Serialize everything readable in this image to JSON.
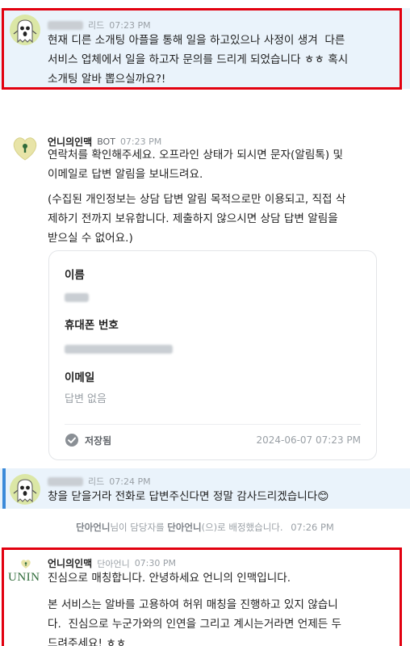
{
  "colors": {
    "highlight": "#e2000f",
    "user_bg": "#eaf3fb",
    "accent_bar": "#3b8ad9"
  },
  "messages": [
    {
      "role_tag": "리드",
      "time": "07:23 PM",
      "text": "현재 디른 소개팅 아플을 통해 일을 하고있으나 사정이 생겨  다른\n서비스 업체에서 일을 하고자 문의를 드리게 되었습니다 ㅎㅎ 혹시\n소개팅 알바 뽑으실까요?!"
    },
    {
      "name": "언니의인맥",
      "tag": "BOT",
      "time": "07:23 PM",
      "text1": "연락처를 확인해주세요. 오프라인 상태가 되시면 문자(알림톡) 및\n이메일로 답변 알림을 보내드려요.",
      "text2": "(수집된 개인정보는 상담 답변 알림 목적으로만 이용되고, 직접 삭\n제하기 전까지 보유합니다. 제출하지 않으시면 상담 답변 알림을\n받으실 수 없어요.)"
    },
    {
      "role_tag": "리드",
      "time": "07:24 PM",
      "text": "창을 닫을거라 전화로 답변주신다면 정말 감사드리겠습니다",
      "emoji": "😊"
    },
    {
      "name": "언니의인맥",
      "subname": "단아언니",
      "time": "07:30 PM",
      "text1": "진심으로 매칭합니다. 안녕하세요 언니의 인맥입니다.",
      "text2": "본 서비스는 알바를 고용하여 허위 매칭을 진행하고 있지 않습니\n다.  진심으로 누군가와의 인연을 그리고 계시는거라면 언제든 두\n드려주세요! ㅎㅎ"
    }
  ],
  "form_card": {
    "name_label": "이름",
    "phone_label": "휴대폰 번호",
    "email_label": "이메일",
    "email_value": "답변 없음",
    "saved_label": "저장됨",
    "saved_time": "2024-06-07 07:23 PM"
  },
  "assignment": {
    "agent": "단아언니",
    "text_mid": "님이 담당자를 ",
    "agent2": "단아언니",
    "text_end": "(으)로 배정했습니다.",
    "time": "07:26 PM"
  },
  "logo_text": "UNIN"
}
